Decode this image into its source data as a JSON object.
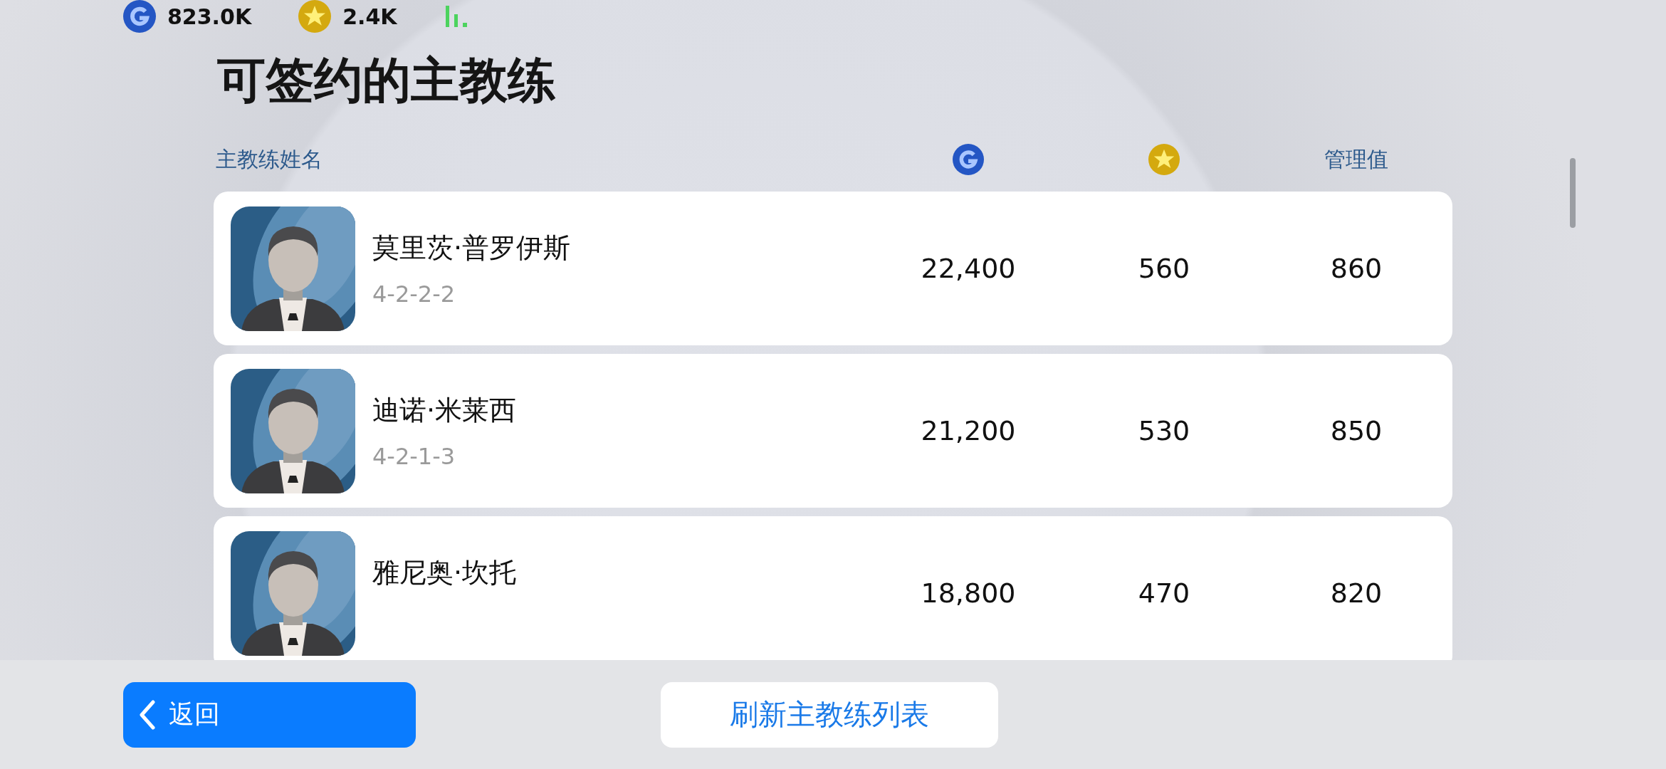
{
  "currencies": [
    {
      "kind": "gp",
      "amount": "823.0K"
    },
    {
      "kind": "coin",
      "amount": "2.4K"
    }
  ],
  "title": "可签约的主教练",
  "table": {
    "columns": [
      {
        "kind": "text",
        "label": "主教练姓名"
      },
      {
        "kind": "gp"
      },
      {
        "kind": "coin"
      },
      {
        "kind": "text",
        "label": "管理值"
      }
    ],
    "rows": [
      {
        "name": "莫里茨·普罗伊斯",
        "formation": "4-2-2-2",
        "gp": "22,400",
        "coins": "560",
        "management": "860"
      },
      {
        "name": "迪诺·米莱西",
        "formation": "4-2-1-3",
        "gp": "21,200",
        "coins": "530",
        "management": "850"
      },
      {
        "name": "雅尼奥·坎托",
        "gp": "18,800",
        "coins": "470",
        "management": "820"
      }
    ]
  },
  "buttons": [
    {
      "kind": "back",
      "label": "返回"
    },
    {
      "kind": "refresh",
      "label": "刷新主教练列表"
    }
  ]
}
